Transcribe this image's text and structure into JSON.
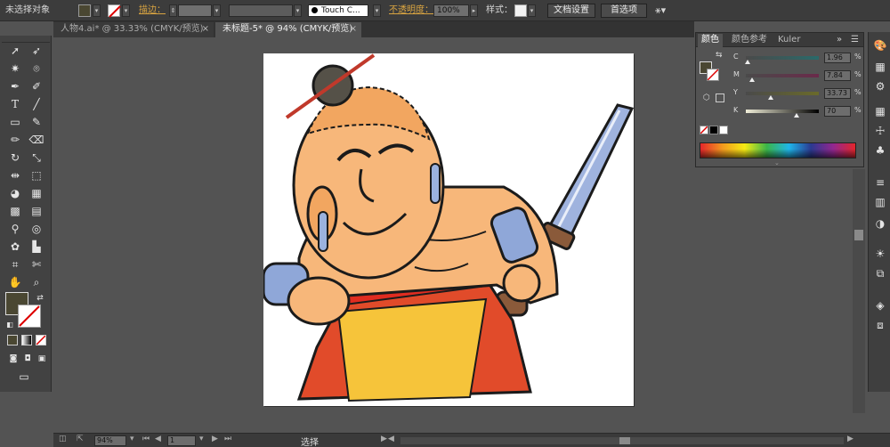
{
  "control_bar": {
    "selection_status": "未选择对象",
    "stroke_label": "描边：",
    "font_name": "Touch C...",
    "opacity_label": "不透明度：",
    "opacity_value": "100%",
    "style_label": "样式：",
    "doc_setup": "文档设置",
    "preferences": "首选项"
  },
  "tabs": [
    {
      "label": "人物4.ai* @ 33.33% (CMYK/预览)",
      "close": "×"
    },
    {
      "label": "未标题-5* @ 94% (CMYK/预览)",
      "close": "×"
    }
  ],
  "color_panel": {
    "tabs": [
      "颜色",
      "颜色参考",
      "Kuler"
    ],
    "channels": [
      {
        "name": "C",
        "value": "1.96",
        "unit": "%",
        "level": 0.02
      },
      {
        "name": "M",
        "value": "7.84",
        "unit": "%",
        "level": 0.08
      },
      {
        "name": "Y",
        "value": "33.73",
        "unit": "%",
        "level": 0.34
      },
      {
        "name": "K",
        "value": "70",
        "unit": "%",
        "level": 0.7
      }
    ]
  },
  "status_bar": {
    "zoom": "94%",
    "page": "1",
    "mode": "选择"
  },
  "colors": {
    "fill_swatch": "#4a4732",
    "bg": "#535353"
  },
  "icons": [
    "selection-tool-icon",
    "direct-selection-icon",
    "pen-icon",
    "type-icon",
    "line-icon",
    "rectangle-icon",
    "brush-icon",
    "pencil-icon",
    "eraser-icon",
    "rotate-icon",
    "scale-icon",
    "eyedropper-icon",
    "gradient-icon",
    "hand-icon",
    "zoom-icon",
    "artboard-icon"
  ]
}
